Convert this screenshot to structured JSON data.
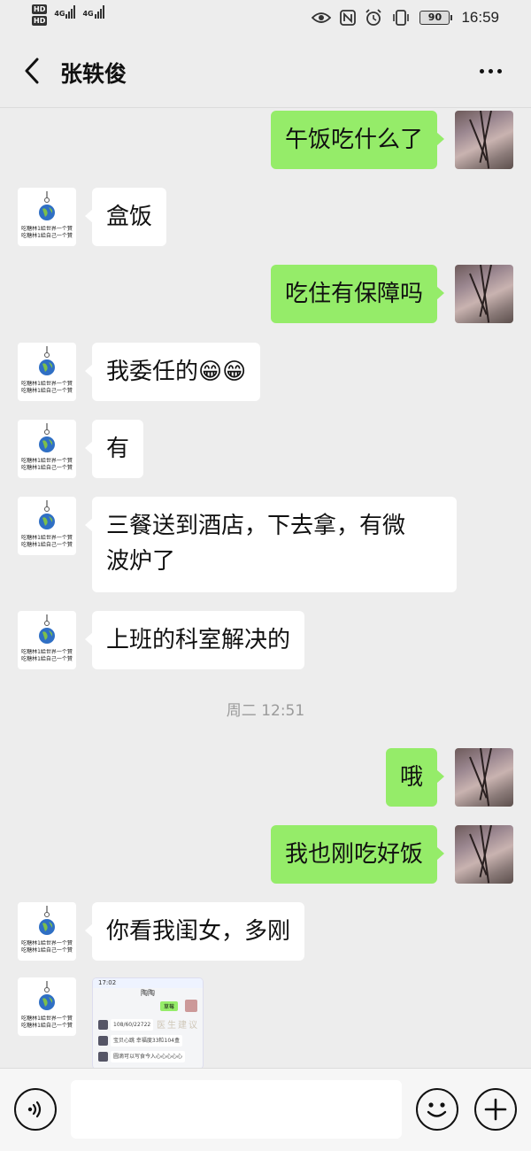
{
  "status_bar": {
    "sim1_tag": "HD",
    "sim2_tag": "HD",
    "network1": "4G",
    "network2": "4G",
    "battery": "90",
    "time": "16:59",
    "icons": [
      "eye-icon",
      "nfc-icon",
      "alarm-icon",
      "vibrate-icon",
      "battery-icon"
    ]
  },
  "header": {
    "title": "张轶俊",
    "back_icon": "chevron-left-icon",
    "more_icon": "more-dots-icon"
  },
  "messages": [
    {
      "from": "me",
      "text": "午饭吃什么了"
    },
    {
      "from": "other",
      "text": "盒饭"
    },
    {
      "from": "me",
      "text": "吃住有保障吗"
    },
    {
      "from": "other",
      "text": "我委任的😁😁"
    },
    {
      "from": "other",
      "text": "有"
    },
    {
      "from": "other",
      "text": "三餐送到酒店，下去拿，有微\n波炉了"
    },
    {
      "from": "other",
      "text": "上班的科室解决的"
    },
    {
      "from": "me",
      "text": "哦"
    },
    {
      "from": "me",
      "text": "我也刚吃好饭"
    },
    {
      "from": "other",
      "text": "你看我闺女，多刚"
    },
    {
      "from": "other",
      "type": "image"
    }
  ],
  "timestamp": "周二 12:51",
  "avatar_other": {
    "line1": "吃糖林1給世界一个贊",
    "line2": "吃糖林1給自己一个贊"
  },
  "image_preview": {
    "time": "17:02",
    "title": "陶陶",
    "row1": "108/60/22722",
    "row2": "宝贝心跳 幸福度33粒104盒",
    "row3": "圆滴可以写食今入心心心心心",
    "green_tag": "草莓",
    "watermark": "医生建议"
  },
  "input_bar": {
    "voice_icon": "voice-icon",
    "emoji_icon": "emoji-icon",
    "plus_icon": "plus-icon",
    "input_value": ""
  },
  "colors": {
    "bubble_me": "#95ec69",
    "bubble_other": "#ffffff",
    "background": "#ededed"
  }
}
